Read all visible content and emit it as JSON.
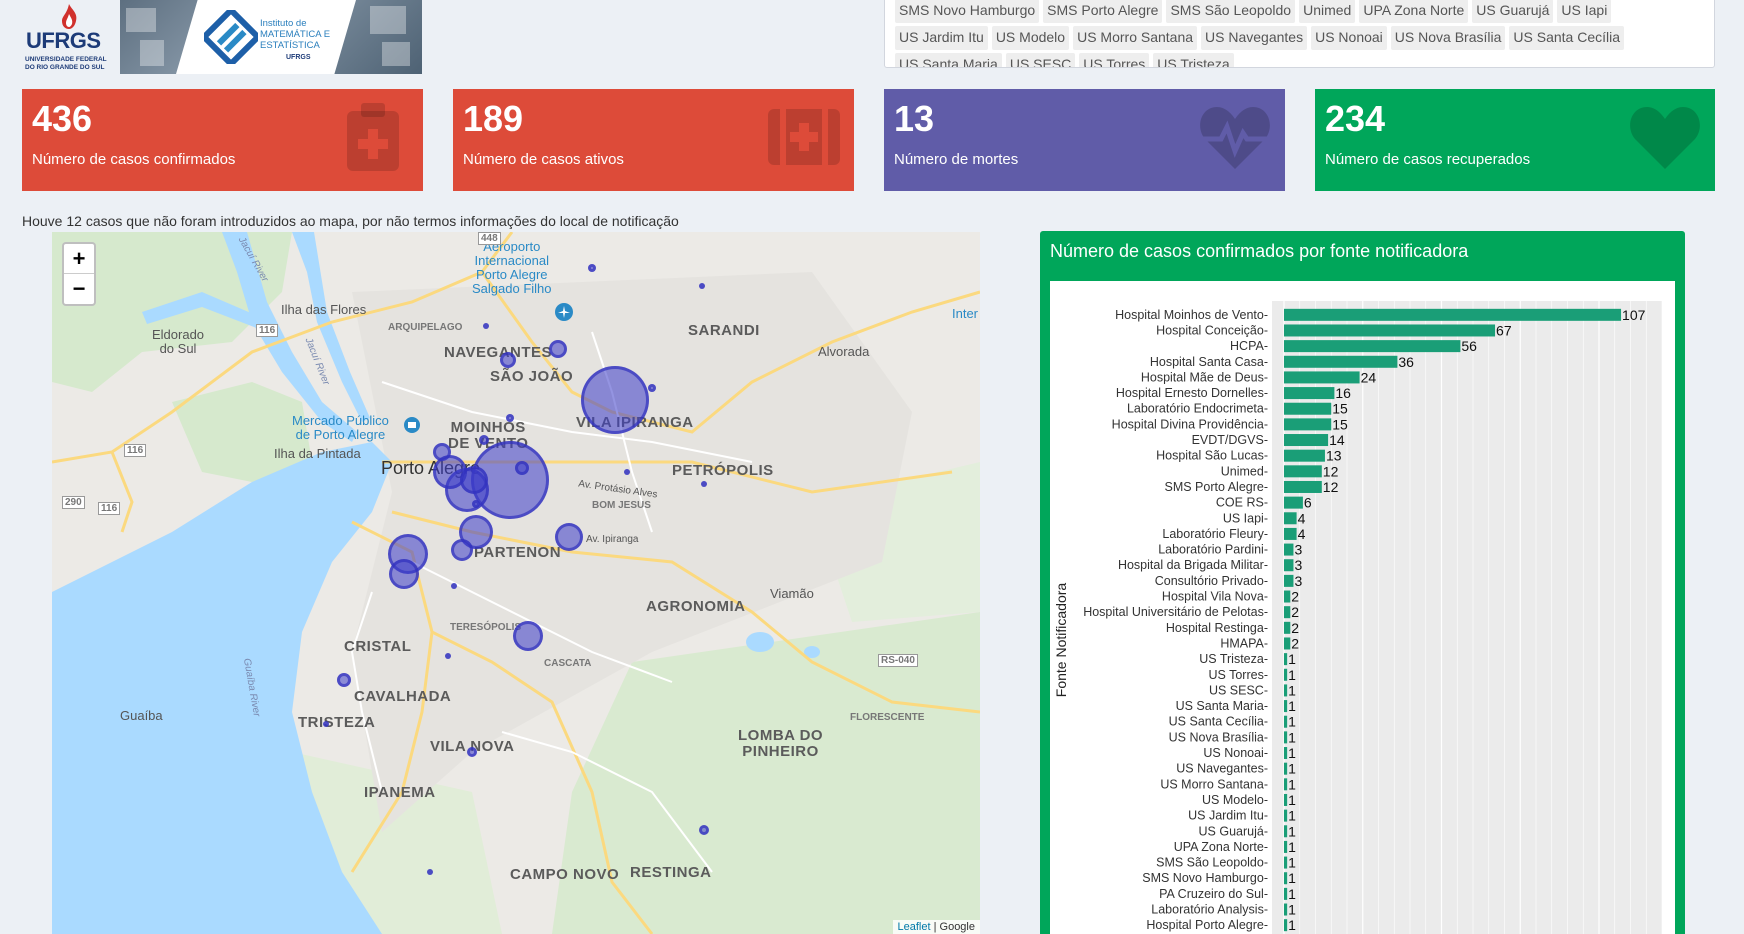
{
  "header": {
    "ufrgs_logo_text": "UFRGS",
    "ufrgs_logo_subtitle": "UNIVERSIDADE FEDERAL DO RIO GRANDE DO SUL",
    "ime_logo_text": "Instituto de MATEMÁTICA E ESTATÍSTICA",
    "ime_logo_ufrgs": "UFRGS"
  },
  "filter_tags": [
    "SMS Novo Hamburgo",
    "SMS Porto Alegre",
    "SMS São Leopoldo",
    "Unimed",
    "UPA Zona Norte",
    "US Guarujá",
    "US Iapi",
    "US Jardim Itu",
    "US Modelo",
    "US Morro Santana",
    "US Navegantes",
    "US Nonoai",
    "US Nova Brasília",
    "US Santa Cecília",
    "US Santa Maria",
    "US SESC",
    "US Torres",
    "US Tristeza"
  ],
  "stats": [
    {
      "value": "436",
      "label": "Número de casos confirmados",
      "color": "#dd4b39",
      "icon": "medkit-icon"
    },
    {
      "value": "189",
      "label": "Número de casos ativos",
      "color": "#dd4b39",
      "icon": "first-aid-icon"
    },
    {
      "value": "13",
      "label": "Número de mortes",
      "color": "#605ca8",
      "icon": "heartbeat-icon"
    },
    {
      "value": "234",
      "label": "Número de casos recuperados",
      "color": "#00a65a",
      "icon": "heart-icon"
    }
  ],
  "map": {
    "note": "Houve 12 casos que não foram introduzidos ao mapa, por não termos informações do local de notificação",
    "zoom_in": "+",
    "zoom_out": "−",
    "attribution_leaflet": "Leaflet",
    "attribution_sep": " | ",
    "attribution_google": "Google",
    "places": {
      "porto_alegre": "Porto Alegre",
      "moinhos": "MOINHOS\nDE VENTO",
      "vila_ipiranga": "VILA IPIRANGA",
      "navegantes": "NAVEGANTES",
      "sao_joao": "SÃO JOÃO",
      "sarandi": "SARANDI",
      "alvorada": "Alvorada",
      "petropolis": "PETRÓPOLIS",
      "partenon": "PARTENON",
      "agronomia": "AGRONOMIA",
      "viamao": "Viamão",
      "cristal": "CRISTAL",
      "cavalhada": "CAVALHADA",
      "tristeza": "TRISTEZA",
      "vila_nova": "VILA NOVA",
      "ipanema": "IPANEMA",
      "lomba": "LOMBA DO\nPINHEIRO",
      "campo_novo": "CAMPO NOVO",
      "restinga": "RESTINGA",
      "guaiba": "Guaíba",
      "eldorado": "Eldorado\ndo Sul",
      "ilha_flores": "Ilha das Flores",
      "ilha_pintada": "Ilha da Pintada",
      "mercado": "Mercado Público\nde Porto Alegre",
      "aeroporto": "Aeroporto\nInternacional\nPorto Alegre\nSalgado Filho",
      "bom_jesus": "BOM JESUS",
      "teresopolis": "TERESÓPOLIS",
      "cascata": "CASCATA",
      "florescente": "FLORESCENTE",
      "arquipelago": "ARQUIPELAGO",
      "av_protasio": "Av. Protásio Alves",
      "av_ipiranga": "Av. Ipiranga",
      "jacui1": "Jacuí River",
      "jacui2": "Jacuí River",
      "guaiba_river": "Guaíba River",
      "inter": "Inter",
      "r448": "448",
      "r116a": "116",
      "r116b": "116",
      "r116c": "116",
      "r290": "290",
      "rs040": "RS-040"
    }
  },
  "chart_data": {
    "type": "bar",
    "orientation": "horizontal",
    "title": "Número de casos confirmados por fonte notificadora",
    "ylabel": "Fonte Notificadora",
    "xlim": [
      0,
      120
    ],
    "categories": [
      "Hospital Moinhos de Vento",
      "Hospital Conceição",
      "HCPA",
      "Hospital Santa Casa",
      "Hospital Mãe de Deus",
      "Hospital Ernesto Dornelles",
      "Laboratório Endocrimeta",
      "Hospital Divina Providência",
      "EVDT/DGVS",
      "Hospital São Lucas",
      "Unimed",
      "SMS Porto Alegre",
      "COE RS",
      "US Iapi",
      "Laboratório Fleury",
      "Laboratório Pardini",
      "Hospital da Brigada Militar",
      "Consultório Privado",
      "Hospital Vila Nova",
      "Hospital Universitário de Pelotas",
      "Hospital Restinga",
      "HMAPA",
      "US Tristeza",
      "US Torres",
      "US SESC",
      "US Santa Maria",
      "US Santa Cecília",
      "US Nova Brasília",
      "US Nonoai",
      "US Navegantes",
      "US Morro Santana",
      "US Modelo",
      "US Jardim Itu",
      "US Guarujá",
      "UPA Zona Norte",
      "SMS São Leopoldo",
      "SMS Novo Hamburgo",
      "PA Cruzeiro do Sul",
      "Laboratório Analysis",
      "Hospital Porto Alegre"
    ],
    "values": [
      107,
      67,
      56,
      36,
      24,
      16,
      15,
      15,
      14,
      13,
      12,
      12,
      6,
      4,
      4,
      3,
      3,
      3,
      2,
      2,
      2,
      2,
      1,
      1,
      1,
      1,
      1,
      1,
      1,
      1,
      1,
      1,
      1,
      1,
      1,
      1,
      1,
      1,
      1,
      1
    ],
    "bar_color": "#1a9e77"
  }
}
